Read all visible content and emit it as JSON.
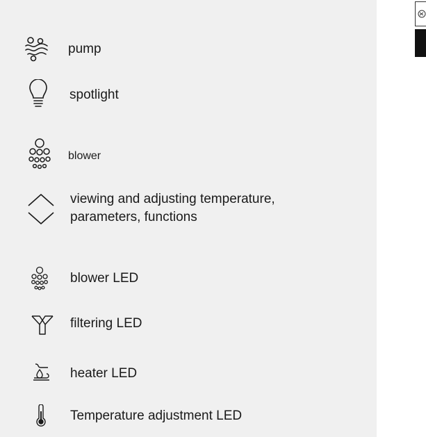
{
  "legend": {
    "items": [
      {
        "icon": "pump-icon",
        "label": "pump"
      },
      {
        "icon": "spotlight-icon",
        "label": "spotlight"
      },
      {
        "icon": "blower-icon",
        "label": "blower"
      },
      {
        "icon": "up-down-arrows-icon",
        "label_line1": "viewing and adjusting temperature,",
        "label_line2": "parameters, functions"
      },
      {
        "icon": "blower-led-icon",
        "label": "blower LED"
      },
      {
        "icon": "filtering-led-icon",
        "label": "filtering LED"
      },
      {
        "icon": "heater-led-icon",
        "label": "heater LED"
      },
      {
        "icon": "thermometer-icon",
        "label": "Temperature adjustment LED"
      }
    ]
  },
  "colors": {
    "panel_bg": "#f0f0f0",
    "icon_stroke": "#1a1a1a",
    "text": "#1a1a1a"
  }
}
